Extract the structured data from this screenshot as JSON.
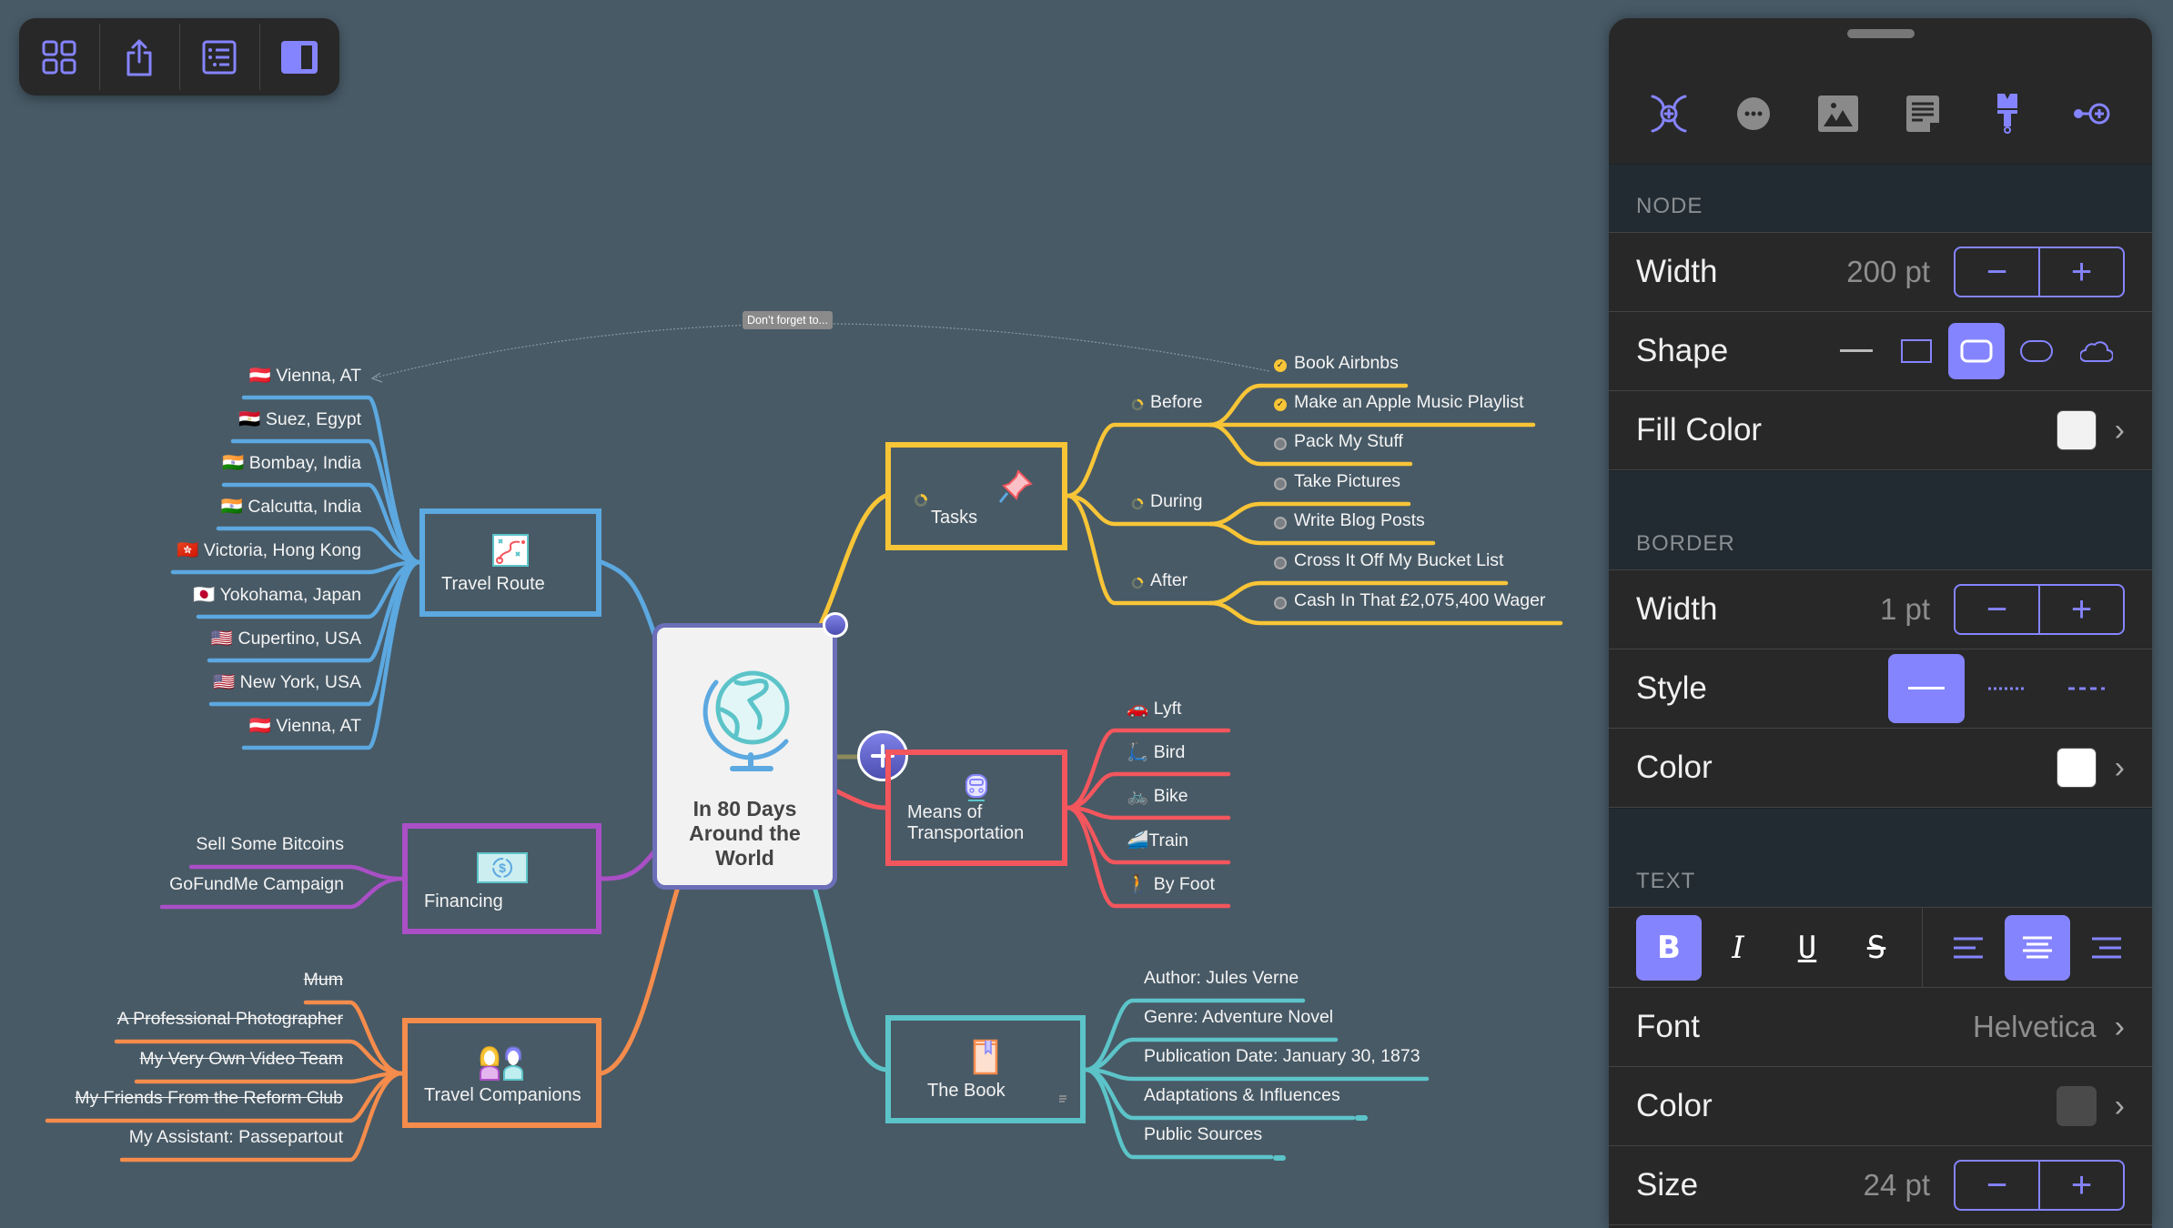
{
  "toolbar": {
    "buttons": [
      {
        "name": "grid-view",
        "icon": "grid-icon"
      },
      {
        "name": "share",
        "icon": "share-icon"
      },
      {
        "name": "outline",
        "icon": "outline-list-icon"
      },
      {
        "name": "inspector-toggle",
        "icon": "sidebar-icon",
        "active": true
      }
    ]
  },
  "accent": "#8584ff",
  "mindmap": {
    "central": {
      "title": "In 80 Days Around the World",
      "icon": "globe-icon",
      "border_color": "#6b6fb8"
    },
    "callout": "Don’t forget to...",
    "branches": {
      "travel_route": {
        "label": "Travel Route",
        "color": "#5ca8e0",
        "icon": "route-map-icon",
        "children": [
          "🇦🇹 Vienna, AT",
          "🇪🇬 Suez, Egypt",
          "🇮🇳 Bombay, India",
          "🇮🇳 Calcutta, India",
          "🇭🇰 Victoria, Hong Kong",
          "🇯🇵 Yokohama, Japan",
          "🇺🇸 Cupertino, USA",
          "🇺🇸 New York, USA",
          "🇦🇹 Vienna, AT"
        ]
      },
      "financing": {
        "label": "Financing",
        "color": "#aa4fc6",
        "icon": "dollar-bill-icon",
        "children": [
          "Sell Some Bitcoins",
          "GoFundMe Campaign"
        ]
      },
      "companions": {
        "label": "Travel Companions",
        "color": "#f58c4c",
        "icon": "people-icon",
        "children": [
          {
            "text": "Mum",
            "struck": true
          },
          {
            "text": "A Professional Photographer",
            "struck": true
          },
          {
            "text": "My Very Own Video Team",
            "struck": true
          },
          {
            "text": "My Friends From the Reform Club",
            "struck": true
          },
          {
            "text": "My Assistant: Passepartout",
            "struck": false
          }
        ]
      },
      "tasks": {
        "label": "Tasks",
        "color": "#f8c537",
        "icon": "pushpin-icon",
        "groups": [
          {
            "label": "Before",
            "items": [
              {
                "text": "Book Airbnbs",
                "done": true
              },
              {
                "text": "Make an Apple Music Playlist",
                "done": true
              },
              {
                "text": "Pack My Stuff",
                "done": false
              }
            ]
          },
          {
            "label": "During",
            "items": [
              {
                "text": "Take Pictures",
                "done": false
              },
              {
                "text": "Write Blog Posts",
                "done": false
              }
            ]
          },
          {
            "label": "After",
            "items": [
              {
                "text": "Cross It Off My Bucket List",
                "done": false
              },
              {
                "text": "Cash In That £2,075,400 Wager",
                "done": false
              }
            ]
          }
        ]
      },
      "transport": {
        "label": "Means of Transportation",
        "label_lines": [
          "Means of",
          "Transportation"
        ],
        "color": "#f3565d",
        "icon": "train-icon",
        "children": [
          "🚗 Lyft",
          "🛴 Bird",
          "🚲 Bike",
          "🚄Train",
          "🚶 By Foot"
        ]
      },
      "book": {
        "label": "The Book",
        "color": "#5cc4c9",
        "icon": "book-icon",
        "children": [
          "Author: Jules Verne",
          "Genre: Adventure Novel",
          "Publication Date: January 30, 1873",
          "Adaptations & Influences",
          "Public Sources"
        ]
      }
    }
  },
  "inspector": {
    "tabs": [
      {
        "name": "topic-style",
        "icon": "topic-style-icon",
        "active": true
      },
      {
        "name": "more",
        "icon": "more-icon"
      },
      {
        "name": "image",
        "icon": "image-icon"
      },
      {
        "name": "notes",
        "icon": "notes-icon"
      },
      {
        "name": "style-brush",
        "icon": "paintbrush-icon",
        "active": true
      },
      {
        "name": "connect",
        "icon": "connection-icon",
        "active": true
      }
    ],
    "node": {
      "section": "NODE",
      "width_label": "Width",
      "width_value": "200 pt",
      "shape_label": "Shape",
      "shape_options": [
        "line",
        "rectangle",
        "rounded-rectangle",
        "capsule",
        "cloud"
      ],
      "shape_selected": "rounded-rectangle",
      "fill_label": "Fill Color",
      "fill_color": "#f2f2f2"
    },
    "border": {
      "section": "BORDER",
      "width_label": "Width",
      "width_value": "1 pt",
      "style_label": "Style",
      "style_options": [
        "solid",
        "dotted",
        "dashed"
      ],
      "style_selected": "solid",
      "color_label": "Color",
      "color": "#ffffff"
    },
    "text": {
      "section": "TEXT",
      "format": [
        {
          "name": "bold",
          "glyph": "B",
          "active": true
        },
        {
          "name": "italic",
          "glyph": "I",
          "active": false
        },
        {
          "name": "underline",
          "glyph": "U",
          "active": false
        },
        {
          "name": "strikethrough",
          "glyph": "S",
          "active": false
        }
      ],
      "align": [
        {
          "name": "align-left",
          "active": false
        },
        {
          "name": "align-center",
          "active": true
        },
        {
          "name": "align-right",
          "active": false
        }
      ],
      "font_label": "Font",
      "font_value": "Helvetica",
      "color_label": "Color",
      "color": "#4a4a4a",
      "size_label": "Size",
      "size_value": "24 pt"
    },
    "stepper": {
      "minus": "−",
      "plus": "+"
    }
  }
}
